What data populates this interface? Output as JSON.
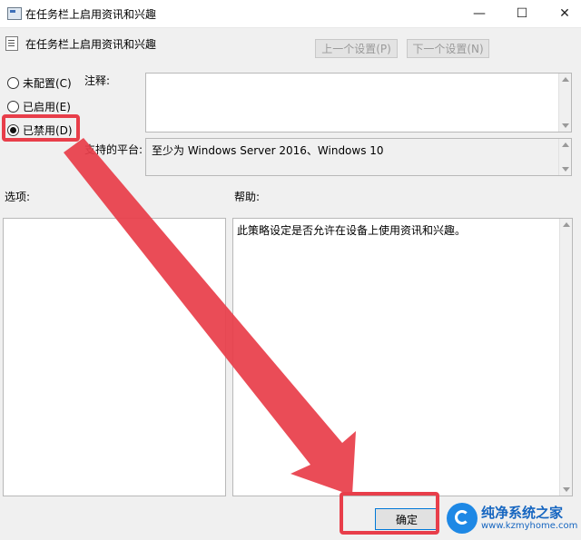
{
  "window": {
    "title": "在任务栏上启用资讯和兴趣",
    "minimize": "—",
    "maximize": "☐",
    "close": "✕"
  },
  "header": {
    "title": "在任务栏上启用资讯和兴趣",
    "prev_label": "上一个设置(P)",
    "next_label": "下一个设置(N)"
  },
  "options": [
    {
      "label": "未配置(C)",
      "selected": false
    },
    {
      "label": "已启用(E)",
      "selected": false
    },
    {
      "label": "已禁用(D)",
      "selected": true
    }
  ],
  "comment": {
    "label": "注释:",
    "value": ""
  },
  "platform": {
    "label": "支持的平台:",
    "value": "至少为 Windows Server 2016、Windows 10"
  },
  "options_section": {
    "label": "选项:"
  },
  "help": {
    "label": "帮助:",
    "text": "此策略设定是否允许在设备上使用资讯和兴趣。"
  },
  "ok_label": "确定",
  "watermark": {
    "name": "纯净系统之家",
    "url": "www.kzmyhome.com"
  },
  "colors": {
    "highlight": "#e83e4a",
    "accent": "#0078d7"
  }
}
